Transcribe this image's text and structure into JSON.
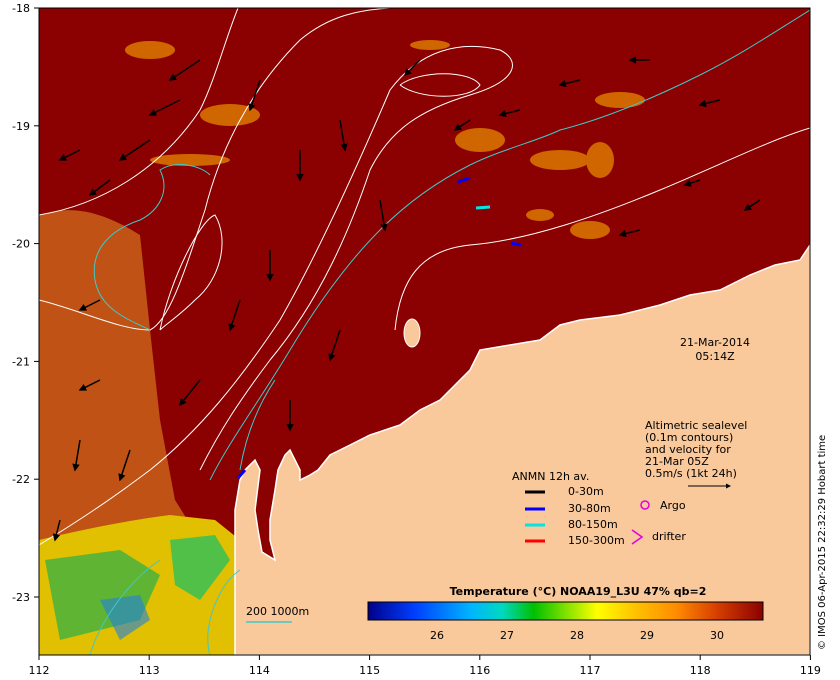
{
  "map": {
    "date": "21-Mar-2014",
    "time": "05:14Z",
    "x_ticks": [
      "112",
      "113",
      "114",
      "115",
      "116",
      "117",
      "118",
      "119"
    ],
    "y_ticks": [
      "-18",
      "-19",
      "-20",
      "-21",
      "-22",
      "-23"
    ],
    "scale_bar": "200  1000m",
    "colors": {
      "ocean_warm": "#8b0000",
      "land": "#f9c89b",
      "contour": "#ffffff",
      "bathymetry": "#40c8c8"
    }
  },
  "altimetry_note": {
    "lines": [
      "Altimetric sealevel",
      "(0.1m contours)",
      "and velocity for",
      "21-Mar 05Z",
      "0.5m/s (1kt 24h)"
    ]
  },
  "legend": {
    "title": "ANMN 12h av.",
    "items": [
      {
        "label": "0-30m",
        "color": "#000000"
      },
      {
        "label": "30-80m",
        "color": "#0000ff"
      },
      {
        "label": "80-150m",
        "color": "#00e5e5"
      },
      {
        "label": "150-300m",
        "color": "#ff0000"
      }
    ],
    "argo": "Argo",
    "drifter": "drifter"
  },
  "colorbar": {
    "title": "Temperature (°C) NOAA19_L3U 47% qb=2",
    "ticks": [
      "26",
      "27",
      "28",
      "29",
      "30"
    ]
  },
  "credit": "© IMOS 06-Apr-2015 22:32:29 Hobart time"
}
